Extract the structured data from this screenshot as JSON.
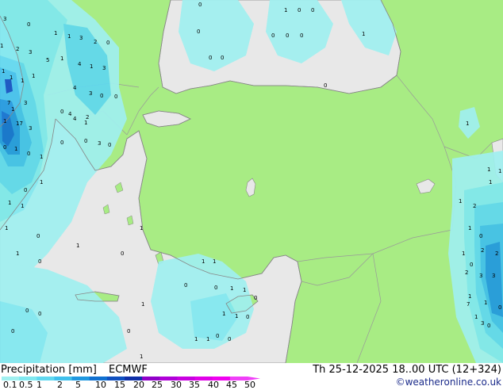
{
  "legend": {
    "title": "Precipitation [mm]",
    "model": "ECMWF",
    "ticks": [
      "0.1",
      "0.5",
      "1",
      "2",
      "5",
      "10",
      "15",
      "20",
      "25",
      "30",
      "35",
      "40",
      "45",
      "50"
    ],
    "colors": [
      "#a0f0f0",
      "#80e8f0",
      "#60d8f0",
      "#40c0ec",
      "#2098e0",
      "#1070d0",
      "#1050c0",
      "#1030a8",
      "#9000c8",
      "#b000d8",
      "#c800e0",
      "#e000e8",
      "#f000f0",
      "#f040f8"
    ]
  },
  "valid_time": "Th 25-12-2025 18..00 UTC (12+324)",
  "credit": "©weatheronline.co.uk",
  "map_colors": {
    "land": "#a8ec84",
    "sea": "#e8e8e8",
    "coast": "#888888"
  },
  "map_labels": {
    "black_sea": [
      "1",
      "0",
      "0",
      "0",
      "0",
      "0",
      "0",
      "0",
      "0",
      "0",
      "1",
      "0"
    ],
    "balkans": [
      "3",
      "0",
      "1",
      "1",
      "3",
      "2",
      "0",
      "1",
      "2",
      "3",
      "5",
      "1",
      "4",
      "1",
      "3",
      "1",
      "1",
      "1",
      "1",
      "4",
      "3",
      "0",
      "0",
      "7",
      "17",
      "3",
      "1",
      "1",
      "3",
      "2",
      "4",
      "4",
      "3",
      "0",
      "1",
      "0",
      "1",
      "0"
    ],
    "aegean": [
      "0",
      "1",
      "0",
      "1",
      "0",
      "1",
      "1",
      "1",
      "1",
      "0",
      "0",
      "1",
      "1",
      "0",
      "0"
    ],
    "mediterranean": [
      "0",
      "0",
      "1",
      "1",
      "0",
      "1",
      "1",
      "1",
      "1",
      "0",
      "1",
      "1",
      "0",
      "0",
      "1",
      "0",
      "0",
      "0",
      "0",
      "1"
    ],
    "levant_east": [
      "1",
      "1",
      "1",
      "0",
      "1",
      "2",
      "2",
      "3",
      "3",
      "2",
      "1",
      "0",
      "7",
      "0",
      "1",
      "3",
      "1",
      "1",
      "1",
      "2",
      "1",
      "0"
    ]
  }
}
